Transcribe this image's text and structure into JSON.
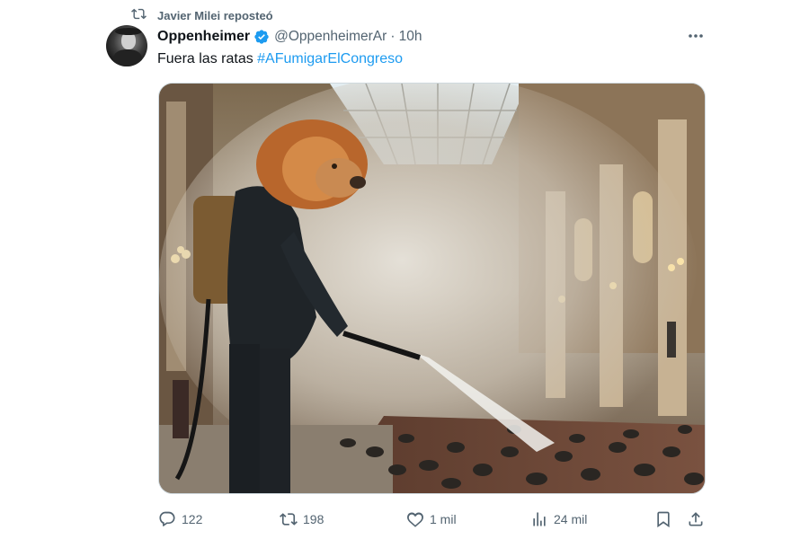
{
  "repost": {
    "icon": "repost-icon",
    "text": "Javier Milei reposteó"
  },
  "tweet": {
    "author_name": "Oppenheimer",
    "verified_icon": "verified-badge-icon",
    "handle": "@OppenheimerAr",
    "separator": "·",
    "time": "10h",
    "text_plain": "Fuera las ratas ",
    "hashtag": "#AFumigarElCongreso",
    "image_alt": "lion-exterminator-congress-image"
  },
  "actions": {
    "reply_count": "122",
    "repost_count": "198",
    "like_count": "1 mil",
    "views_count": "24 mil"
  },
  "colors": {
    "link": "#1d9bf0",
    "verified": "#1d9bf0",
    "muted": "#536471",
    "text": "#0f1419"
  }
}
